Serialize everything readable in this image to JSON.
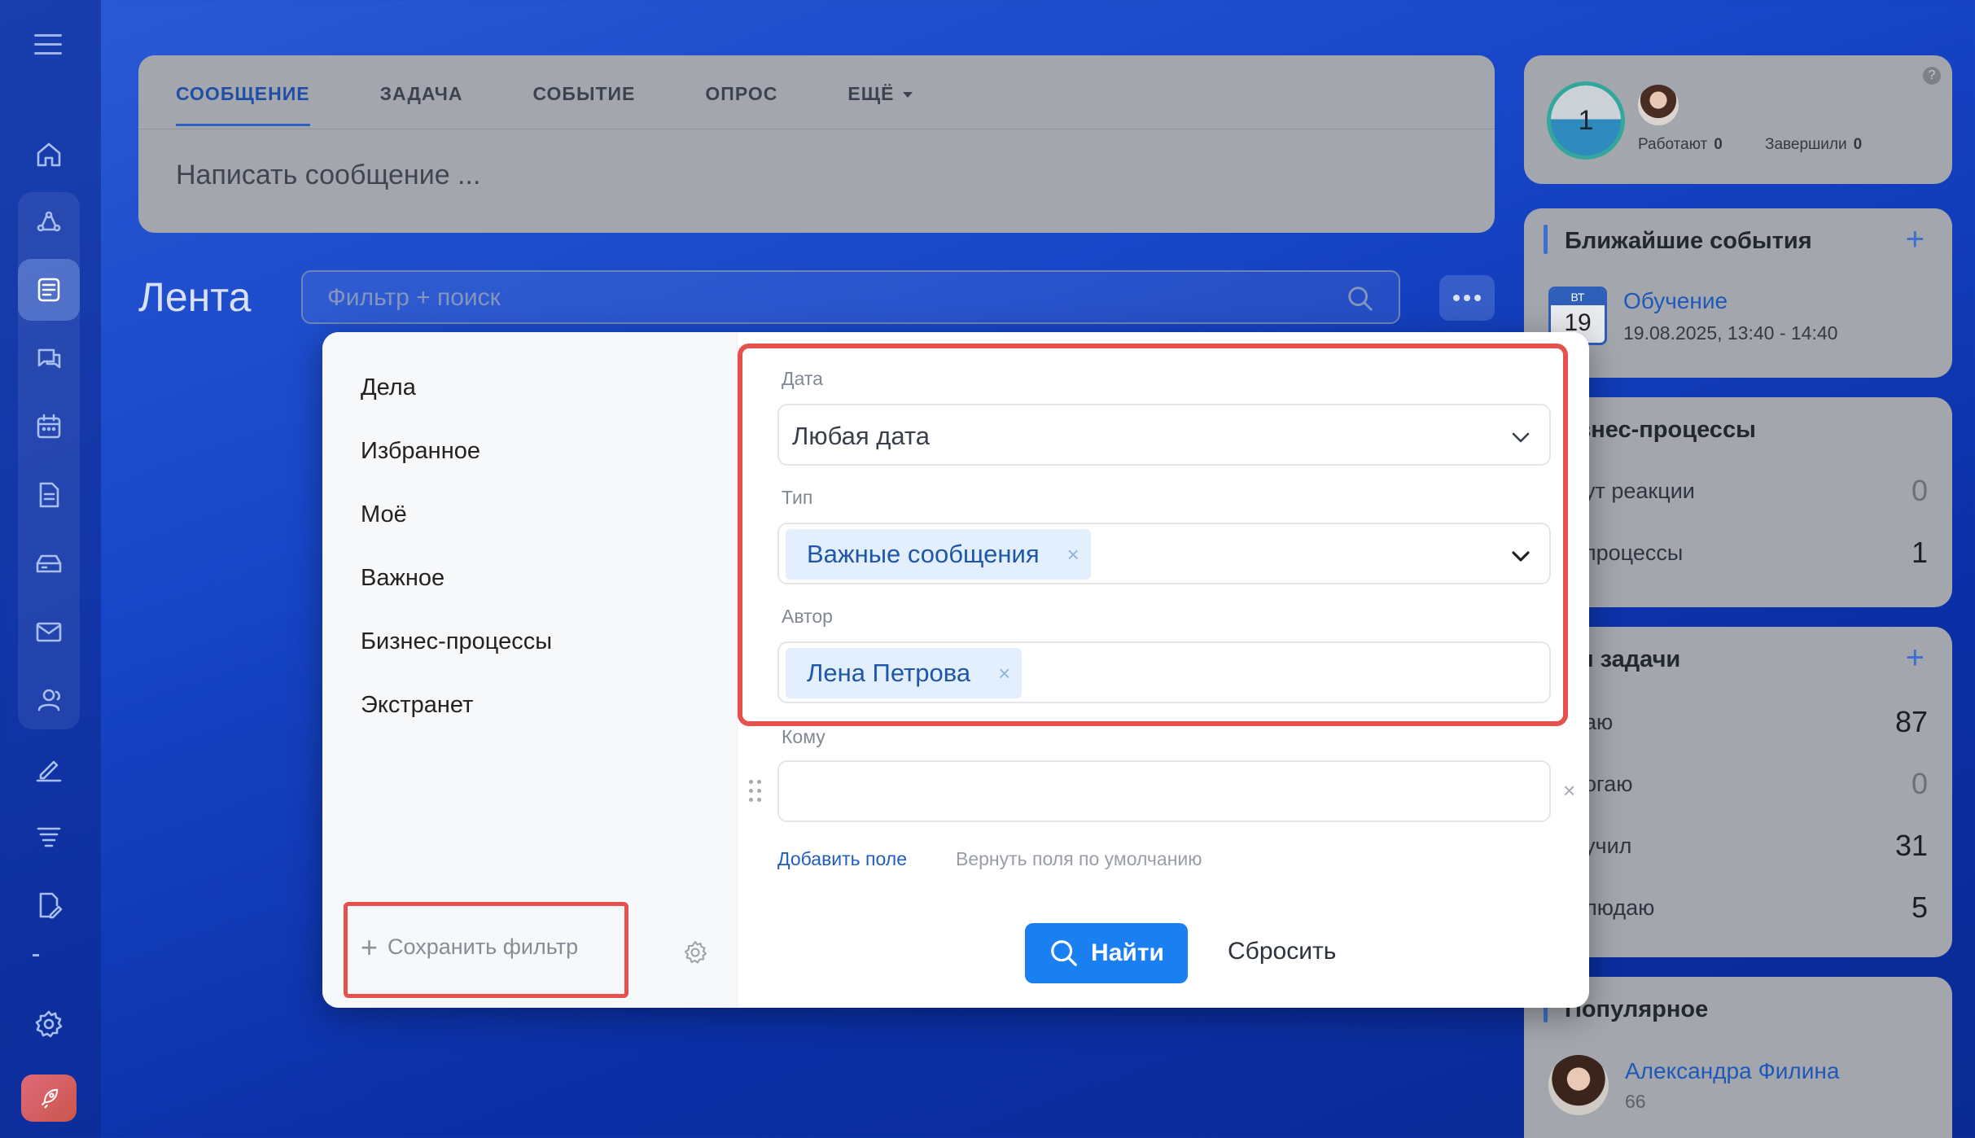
{
  "composer": {
    "tabs": [
      "СООБЩЕНИЕ",
      "ЗАДАЧА",
      "СОБЫТИЕ",
      "ОПРОС",
      "ЕЩЁ"
    ],
    "active_tab": "СООБЩЕНИЕ",
    "placeholder": "Написать сообщение ..."
  },
  "feed": {
    "title": "Лента",
    "search_placeholder": "Фильтр + поиск"
  },
  "status_card": {
    "count": "1",
    "working_label": "Работают",
    "working_value": "0",
    "finished_label": "Завершили",
    "finished_value": "0",
    "help": "?"
  },
  "events_card": {
    "title": "Ближайшие события",
    "plus": "+",
    "weekday": "ВТ",
    "day": "19",
    "event_title": "Обучение",
    "event_time": "19.08.2025, 13:40 - 14:40"
  },
  "bp_card": {
    "title": "изнес-процессы",
    "rows": [
      {
        "label": "ут реакции",
        "value": "0"
      },
      {
        "label": "процессы",
        "value": "1"
      }
    ]
  },
  "tasks_card": {
    "title": "ои задачи",
    "plus": "+",
    "rows": [
      {
        "label": "аю",
        "value": "87"
      },
      {
        "label": "огаю",
        "value": "0"
      },
      {
        "label": "учил",
        "value": "31"
      },
      {
        "label": "людаю",
        "value": "5"
      }
    ]
  },
  "popular_card": {
    "title": "Популярное",
    "name": "Александра Филина",
    "count": "66"
  },
  "filter_popup": {
    "presets": [
      "Дела",
      "Избранное",
      "Моё",
      "Важное",
      "Бизнес-процессы",
      "Экстранет"
    ],
    "save_filter": "Сохранить фильтр",
    "save_plus": "+",
    "fields": {
      "date_label": "Дата",
      "date_value": "Любая дата",
      "type_label": "Тип",
      "type_chip": "Важные сообщения",
      "author_label": "Автор",
      "author_chip": "Лена Петрова",
      "to_label": "Кому"
    },
    "chip_remove": "×",
    "field_remove": "×",
    "add_field": "Добавить поле",
    "restore_fields": "Вернуть поля по умолчанию",
    "find_button": "Найти",
    "reset_button": "Сбросить"
  },
  "colors": {
    "accent": "#1a7ff0",
    "highlight": "#e5524e",
    "link": "#1f5fbf"
  },
  "icons": [
    "menu-icon",
    "home-icon",
    "workflow-icon",
    "feed-icon",
    "chat-icon",
    "calendar-icon",
    "document-icon",
    "drive-icon",
    "mail-icon",
    "contacts-icon",
    "sign-icon",
    "funnel-icon",
    "doc-edit-icon",
    "settings-icon",
    "rocket-icon",
    "search-icon",
    "more-icon",
    "chevron-down-icon",
    "gear-icon",
    "drag-handle-icon"
  ]
}
